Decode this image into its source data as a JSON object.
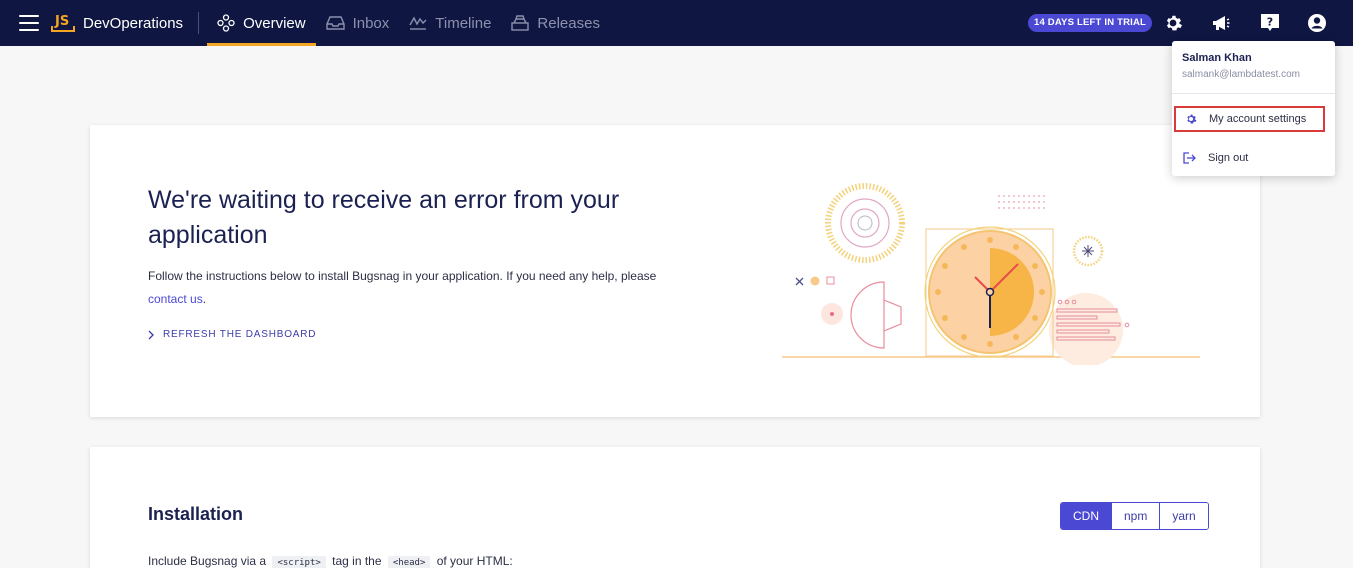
{
  "topbar": {
    "app_logo": "JS",
    "app_name": "DevOperations",
    "tabs": [
      {
        "label": "Overview",
        "icon": "overview-icon",
        "active": true
      },
      {
        "label": "Inbox",
        "icon": "inbox-icon",
        "active": false
      },
      {
        "label": "Timeline",
        "icon": "timeline-icon",
        "active": false
      },
      {
        "label": "Releases",
        "icon": "releases-icon",
        "active": false
      }
    ],
    "trial_badge": "14 DAYS LEFT IN TRIAL",
    "icons": [
      "gear-icon",
      "megaphone-icon",
      "help-icon",
      "user-icon"
    ]
  },
  "hero": {
    "title": "We're waiting to receive an error from your application",
    "desc_prefix": "Follow the instructions below to install Bugsnag in your application. If you need any help, please ",
    "desc_link": "contact us",
    "desc_suffix": ".",
    "refresh_label": "REFRESH THE DASHBOARD"
  },
  "installation": {
    "title": "Installation",
    "options": [
      "CDN",
      "npm",
      "yarn"
    ],
    "selected": "CDN",
    "text_prefix": "Include Bugsnag via a",
    "code1": "<script>",
    "text_mid": "tag in the",
    "code2": "<head>",
    "text_suffix": "of your HTML:"
  },
  "user_menu": {
    "name": "Salman Khan",
    "email": "salmank@lambdatest.com",
    "items": [
      {
        "label": "My account settings",
        "icon": "gear-icon"
      },
      {
        "label": "Sign out",
        "icon": "sign-out-icon"
      }
    ]
  },
  "colors": {
    "topbar_bg": "#0f1642",
    "accent": "#4b49d4",
    "tab_underline": "#f4a524",
    "highlight_border": "#d93a3a"
  }
}
